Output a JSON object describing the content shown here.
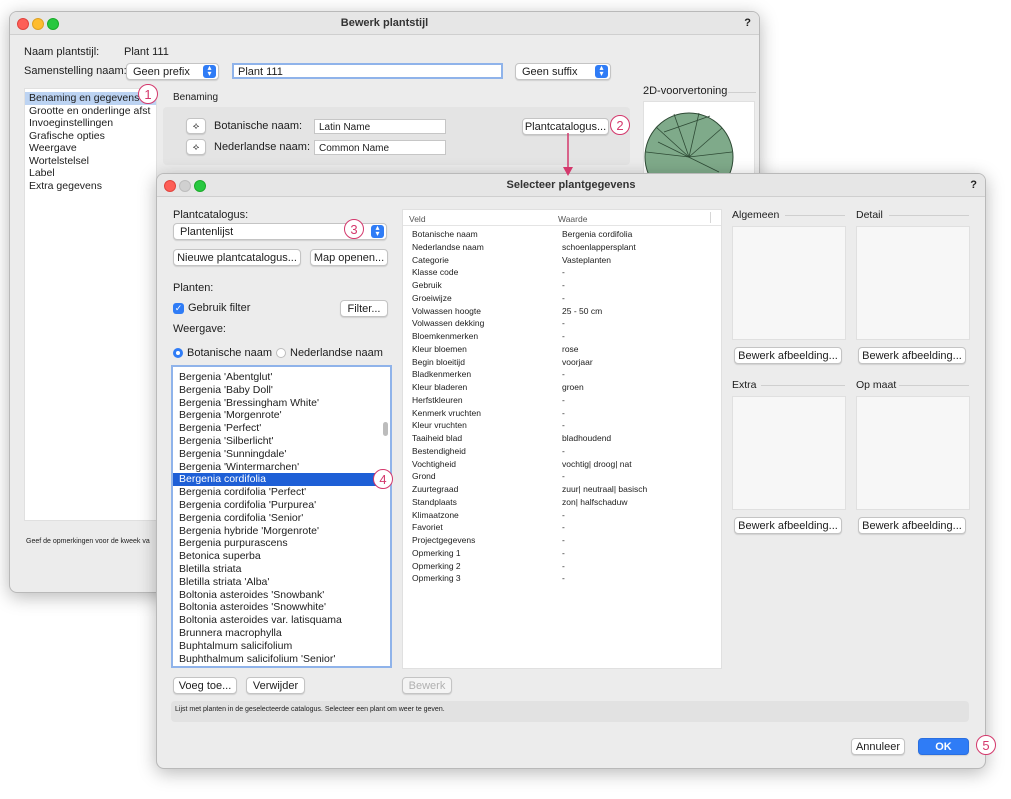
{
  "back_window": {
    "title": "Bewerk plantstijl",
    "help": "?",
    "style_name_label": "Naam plantstijl:",
    "style_name_value": "Plant 111",
    "composition_label": "Samenstelling naam:",
    "prefix_select": "Geen prefix",
    "name_field": "Plant 111",
    "suffix_select": "Geen suffix",
    "sidebar_items": [
      "Benaming en gegevens",
      "Grootte en onderlinge afst",
      "Invoeginstellingen",
      "Grafische opties",
      "Weergave",
      "Wortelstelsel",
      "Label",
      "Extra gegevens"
    ],
    "section_title": "Benaming",
    "botanical_label": "Botanische naam:",
    "botanical_value": "Latin Name",
    "common_label": "Nederlandse naam:",
    "common_value": "Common Name",
    "catalog_button": "Plantcatalogus...",
    "preview_title": "2D-voorvertoning",
    "hint": "Geef de opmerkingen voor de kweek va"
  },
  "dialog": {
    "title": "Selecteer plantgegevens",
    "help": "?",
    "catalog_label": "Plantcatalogus:",
    "catalog_select": "Plantenlijst",
    "new_catalog_button": "Nieuwe plantcatalogus...",
    "open_folder_button": "Map openen...",
    "plants_label": "Planten:",
    "use_filter_label": "Gebruik filter",
    "filter_button": "Filter...",
    "display_label": "Weergave:",
    "radio_botanical": "Botanische naam",
    "radio_common": "Nederlandse naam",
    "plant_list": [
      "Bergenia 'Abentglut'",
      "Bergenia 'Baby Doll'",
      "Bergenia 'Bressingham White'",
      "Bergenia 'Morgenrote'",
      "Bergenia 'Perfect'",
      "Bergenia 'Silberlicht'",
      "Bergenia 'Sunningdale'",
      "Bergenia 'Wintermarchen'",
      "Bergenia cordifolia",
      "Bergenia cordifolia 'Perfect'",
      "Bergenia cordifolia 'Purpurea'",
      "Bergenia cordifolia 'Senior'",
      "Bergenia hybride 'Morgenrote'",
      "Bergenia purpurascens",
      "Betonica superba",
      "Bletilla striata",
      "Bletilla striata 'Alba'",
      "Boltonia asteroides 'Snowbank'",
      "Boltonia asteroides 'Snowwhite'",
      "Boltonia asteroides var. latisquama",
      "Brunnera macrophylla",
      "Buphtalmum salicifolium",
      "Buphthalmum salicifolium 'Senior'"
    ],
    "selected_plant": "Bergenia cordifolia",
    "add_button": "Voeg toe...",
    "remove_button": "Verwijder",
    "edit_button": "Bewerk",
    "table_headers": {
      "field": "Veld",
      "value": "Waarde"
    },
    "table_rows": [
      [
        "Botanische naam",
        "Bergenia cordifolia"
      ],
      [
        "Nederlandse naam",
        "schoenlappersplant"
      ],
      [
        "Categorie",
        "Vasteplanten"
      ],
      [
        "Klasse code",
        "-"
      ],
      [
        "Gebruik",
        "-"
      ],
      [
        "Groeiwijze",
        "-"
      ],
      [
        "Volwassen hoogte",
        "25 - 50 cm"
      ],
      [
        "Volwassen dekking",
        "-"
      ],
      [
        "Bloemkenmerken",
        "-"
      ],
      [
        "Kleur bloemen",
        "rose"
      ],
      [
        "Begin bloeitijd",
        "voorjaar"
      ],
      [
        "Bladkenmerken",
        "-"
      ],
      [
        "Kleur bladeren",
        "groen"
      ],
      [
        "Herfstkleuren",
        "-"
      ],
      [
        "Kenmerk vruchten",
        "-"
      ],
      [
        "Kleur vruchten",
        "-"
      ],
      [
        "Taaiheid blad",
        "bladhoudend"
      ],
      [
        "Bestendigheid",
        "-"
      ],
      [
        "Vochtigheid",
        "vochtig| droog| nat"
      ],
      [
        "Grond",
        "-"
      ],
      [
        "Zuurtegraad",
        "zuur| neutraal| basisch"
      ],
      [
        "Standplaats",
        "zon| halfschaduw"
      ],
      [
        "Klimaatzone",
        "-"
      ],
      [
        "Favoriet",
        "-"
      ],
      [
        "Projectgegevens",
        "-"
      ],
      [
        "Opmerking 1",
        "-"
      ],
      [
        "Opmerking 2",
        "-"
      ],
      [
        "Opmerking 3",
        "-"
      ]
    ],
    "image_sections": {
      "general": "Algemeen",
      "detail": "Detail",
      "extra": "Extra",
      "custom": "Op maat"
    },
    "edit_image_button": "Bewerk afbeelding...",
    "status_text": "Lijst met planten in de geselecteerde catalogus. Selecteer een plant om weer te geven.",
    "cancel_button": "Annuleer",
    "ok_button": "OK"
  },
  "callouts": [
    "1",
    "2",
    "3",
    "4",
    "5"
  ],
  "colors": {
    "accent": "#2f7cf6",
    "selection": "#1e5fd6",
    "callout": "#d4386c",
    "preview_fill": "#7faa8a"
  }
}
